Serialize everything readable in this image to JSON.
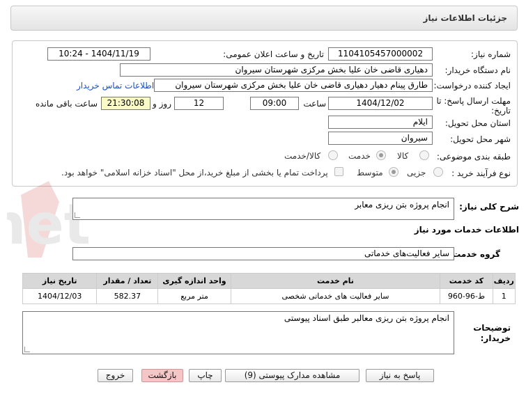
{
  "header": {
    "title": "جزئیات اطلاعات نیاز"
  },
  "form": {
    "need_number_label": "شماره نیاز:",
    "need_number": "1104105457000002",
    "announce_label": "تاریخ و ساعت اعلان عمومی:",
    "announce_value": "1404/11/19 - 10:24",
    "buyer_label": "نام دستگاه خریدار:",
    "buyer_value": "دهیاری قاضی خان علیا بخش مرکزی شهرستان سیروان",
    "creator_label": "ایجاد کننده درخواست:",
    "creator_value": "طارق پینام دهیار دهیاری قاضی خان علیا بخش مرکزی شهرستان سیروان",
    "contact_link": "اطلاعات تماس خریدار",
    "deadline_label_1": "مهلت ارسال پاسخ: تا",
    "deadline_label_2": "تاریخ:",
    "deadline_date": "1404/12/02",
    "time_label": "ساعت",
    "deadline_time": "09:00",
    "days_value": "12",
    "days_label": "روز و",
    "remaining_time": "21:30:08",
    "remaining_label": "ساعت باقی مانده",
    "province_label": "استان محل تحویل:",
    "province_value": "ایلام",
    "city_label": "شهر محل تحویل:",
    "city_value": "سیروان",
    "category_label": "طبقه بندی موضوعی:",
    "category_options": [
      "کالا",
      "خدمت",
      "کالا/خدمت"
    ],
    "category_selected": "خدمت",
    "process_label": "نوع فرآیند خرید :",
    "process_options": [
      "جزیی",
      "متوسط"
    ],
    "process_selected": "متوسط",
    "payment_note": "پرداخت تمام یا بخشی از مبلغ خرید،از محل \"اسناد خزانه اسلامی\" خواهد بود."
  },
  "summary": {
    "label": "شرح کلی نیاز:",
    "value": "انجام پروژه بتن ریزی معابر"
  },
  "services": {
    "section_title": "اطلاعات خدمات مورد نیاز",
    "group_label": "گروه خدمت:",
    "group_value": "سایر فعالیت‌های خدماتی",
    "columns": [
      "ردیف",
      "کد خدمت",
      "نام خدمت",
      "واحد اندازه گیری",
      "تعداد / مقدار",
      "تاریخ نیاز"
    ],
    "rows": [
      [
        "1",
        "ط-96-960",
        "سایر فعالیت های خدماتی شخصی",
        "متر مربع",
        "582.37",
        "1404/12/03"
      ]
    ]
  },
  "notes": {
    "label_1": "توضیحات",
    "label_2": "خریدار:",
    "value": "انجام پروژه بتن ریزی معالبر طبق اسناد پیوستی"
  },
  "buttons": {
    "reply": "پاسخ به نیاز",
    "attachments": "مشاهده مدارک پیوستی (9)",
    "print": "چاپ",
    "back": "بازگشت",
    "exit": "خروج"
  },
  "watermark": {
    "text": "AriaTender.net"
  },
  "colors": {
    "link": "#1a4fc4",
    "highlight": "#fafac8",
    "table_header": "#d8d8d8",
    "pink_button": "#f6c6c6"
  }
}
